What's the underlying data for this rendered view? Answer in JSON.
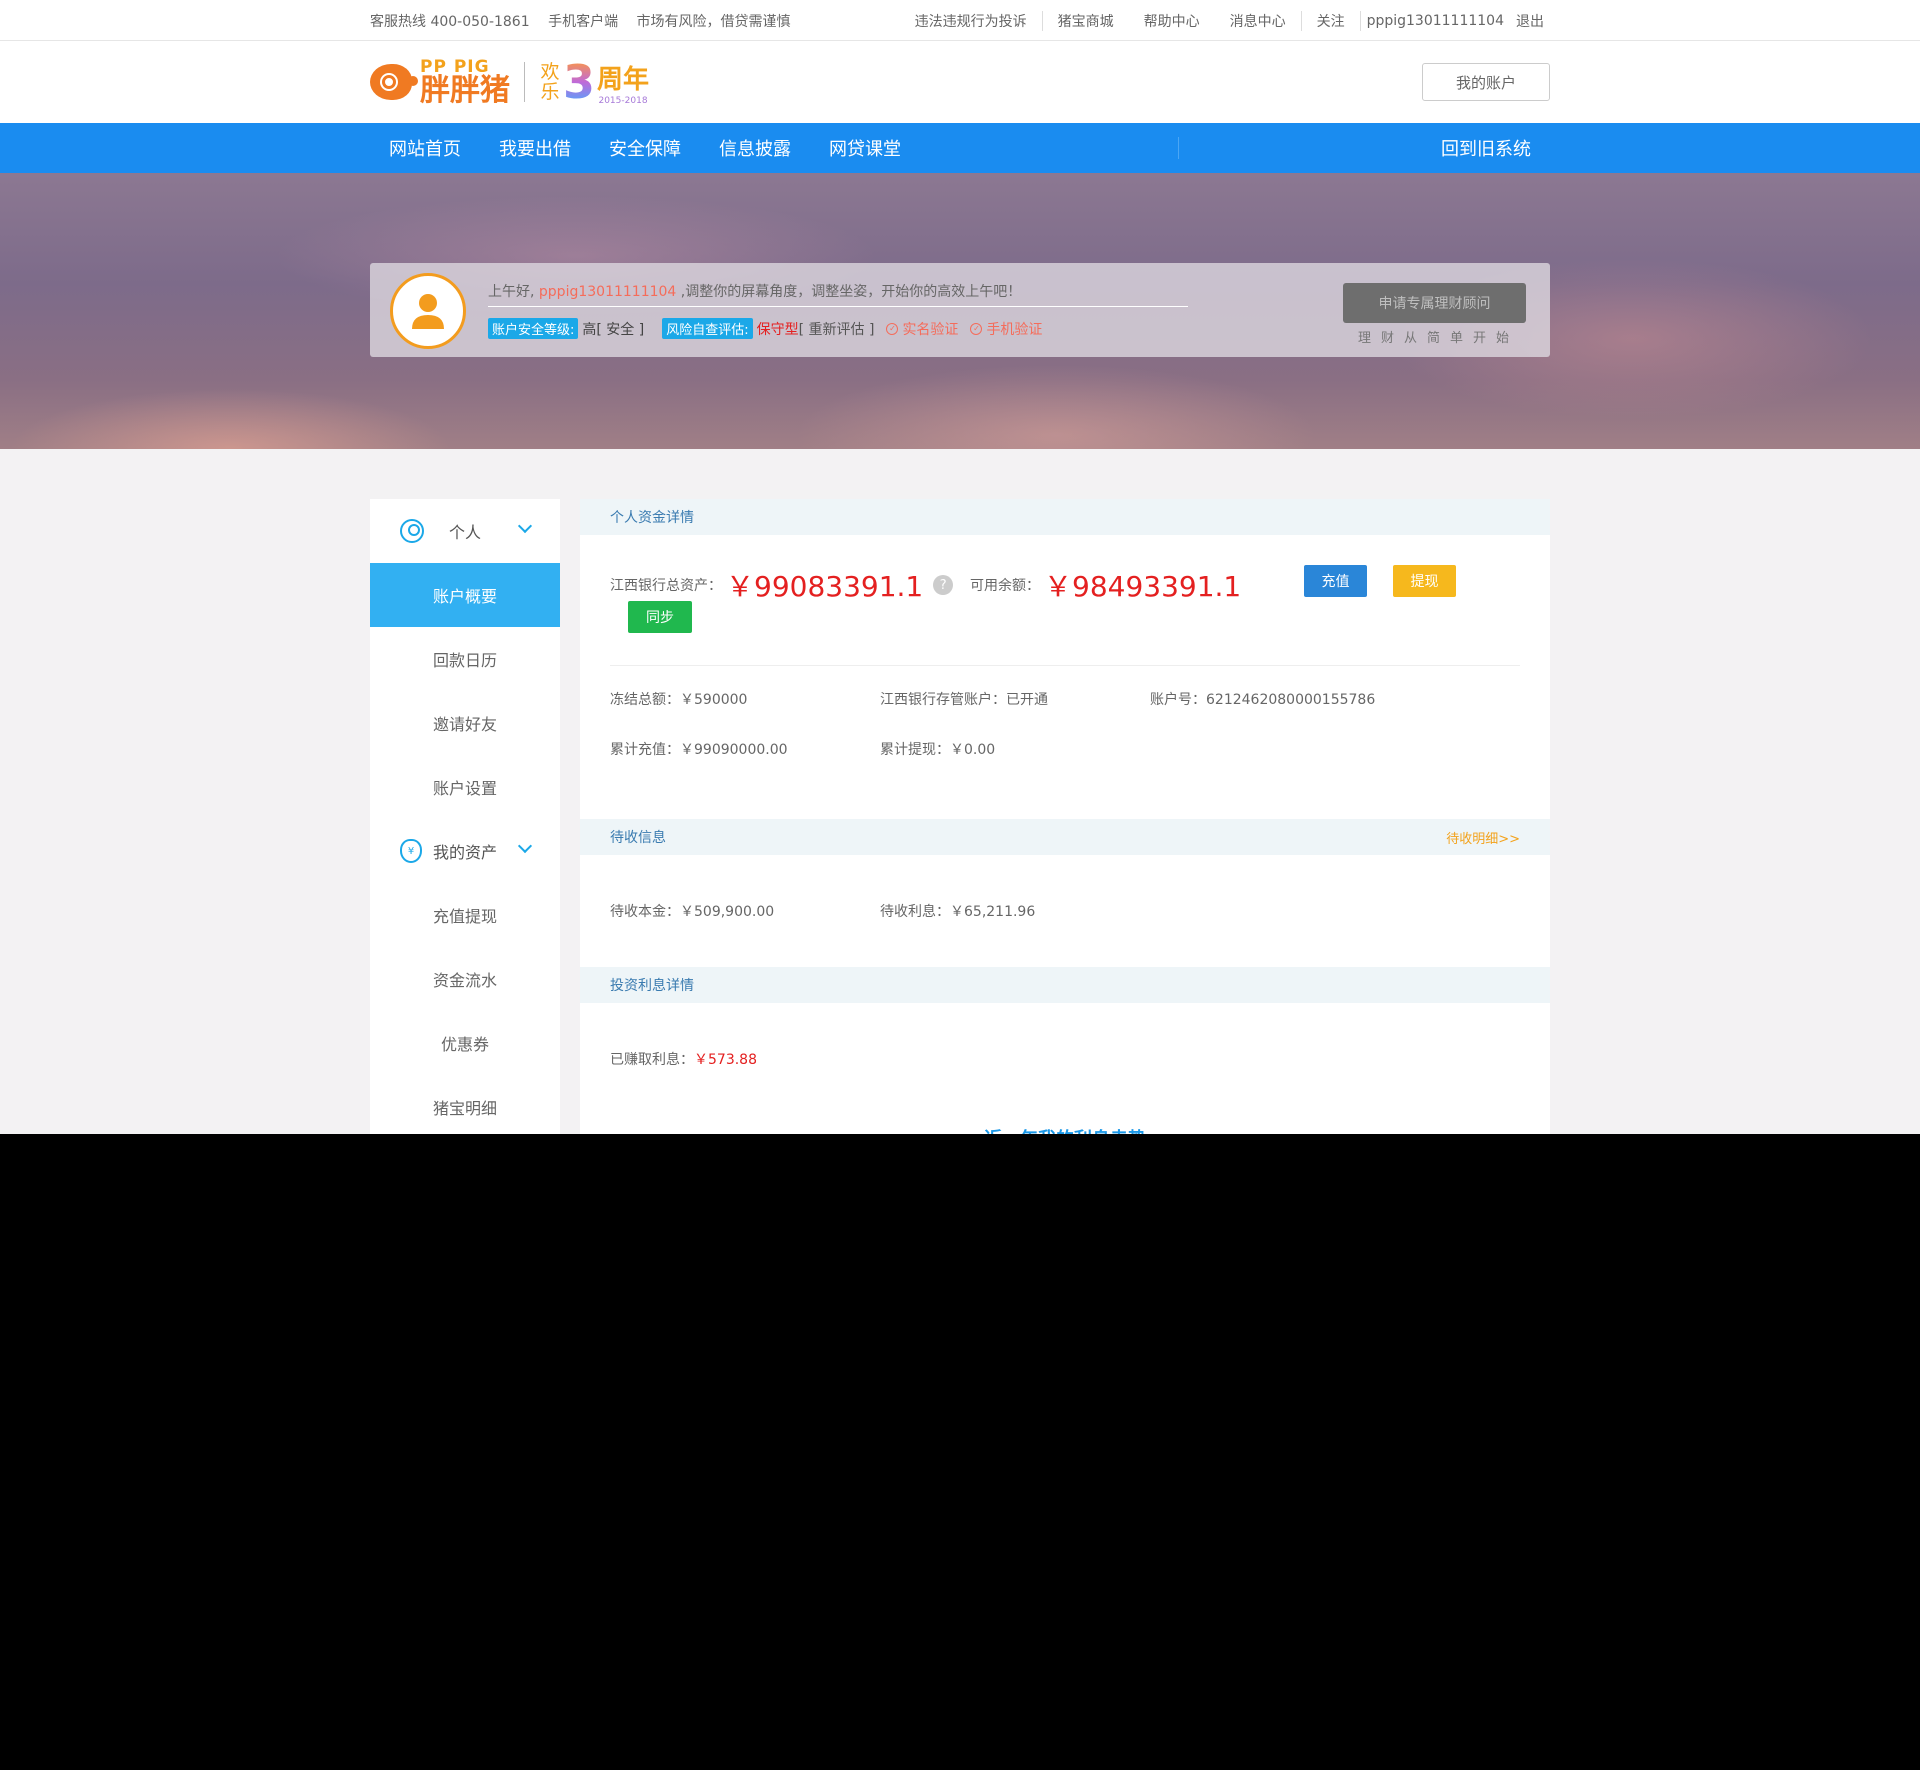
{
  "topbar": {
    "hotline": "客服热线 400-050-1861",
    "mobile": "手机客户端",
    "risk": "市场有风险，借贷需谨慎",
    "links": [
      "违法违规行为投诉",
      "猪宝商城",
      "帮助中心",
      "消息中心",
      "关注"
    ],
    "username": "pppig13011111104",
    "logout": "退出"
  },
  "header": {
    "logo_en": "PP PIG",
    "logo_cn": "胖胖猪",
    "anniv_huan": "欢乐",
    "anniv_three": "3",
    "anniv_zn": "周年",
    "anniv_years": "2015-2018",
    "my_account": "我的账户"
  },
  "nav": {
    "items": [
      "网站首页",
      "我要出借",
      "安全保障",
      "信息披露",
      "网贷课堂"
    ],
    "back": "回到旧系统"
  },
  "profile": {
    "greeting_prefix": "上午好,",
    "username": "pppig13011111104",
    "greeting_suffix": ",调整你的屏幕角度，调整坐姿，开始你的高效上午吧！",
    "security_tag": "账户安全等级:",
    "security_value": "高[ 安全 ]",
    "risk_tag": "风险自查评估:",
    "risk_value": "保守型",
    "reassess": "[ 重新评估 ]",
    "realname": "实名验证",
    "phone": "手机验证",
    "advisor_button": "申请专属理财顾问",
    "advisor_sub": "理财从简单开始"
  },
  "sidebar": {
    "group_personal": "个人",
    "items_personal": [
      "账户概要",
      "回款日历",
      "邀请好友",
      "账户设置"
    ],
    "group_assets": "我的资产",
    "items_assets": [
      "充值提现",
      "资金流水",
      "优惠券",
      "猪宝明细"
    ],
    "active_index": 0
  },
  "main": {
    "section1_title": "个人资金详情",
    "total_label": "江西银行总资产：",
    "total_value": "￥99083391.1",
    "avail_label": "可用余额：",
    "avail_value": "￥98493391.1",
    "recharge": "充值",
    "withdraw": "提现",
    "sync": "同步",
    "frozen": "冻结总额：￥590000",
    "custody": "江西银行存管账户：已开通",
    "account_no": "账户号：6212462080000155786",
    "total_recharge": "累计充值：￥99090000.00",
    "total_withdraw": "累计提现：￥0.00",
    "section2_title": "待收信息",
    "section2_more": "待收明细>>",
    "pending_principal": "待收本金：￥509,900.00",
    "pending_interest": "待收利息：￥65,211.96",
    "section3_title": "投资利息详情",
    "earned_label": "已赚取利息：",
    "earned_value": "￥573.88",
    "chart_title": "近一年我的利息走势"
  }
}
